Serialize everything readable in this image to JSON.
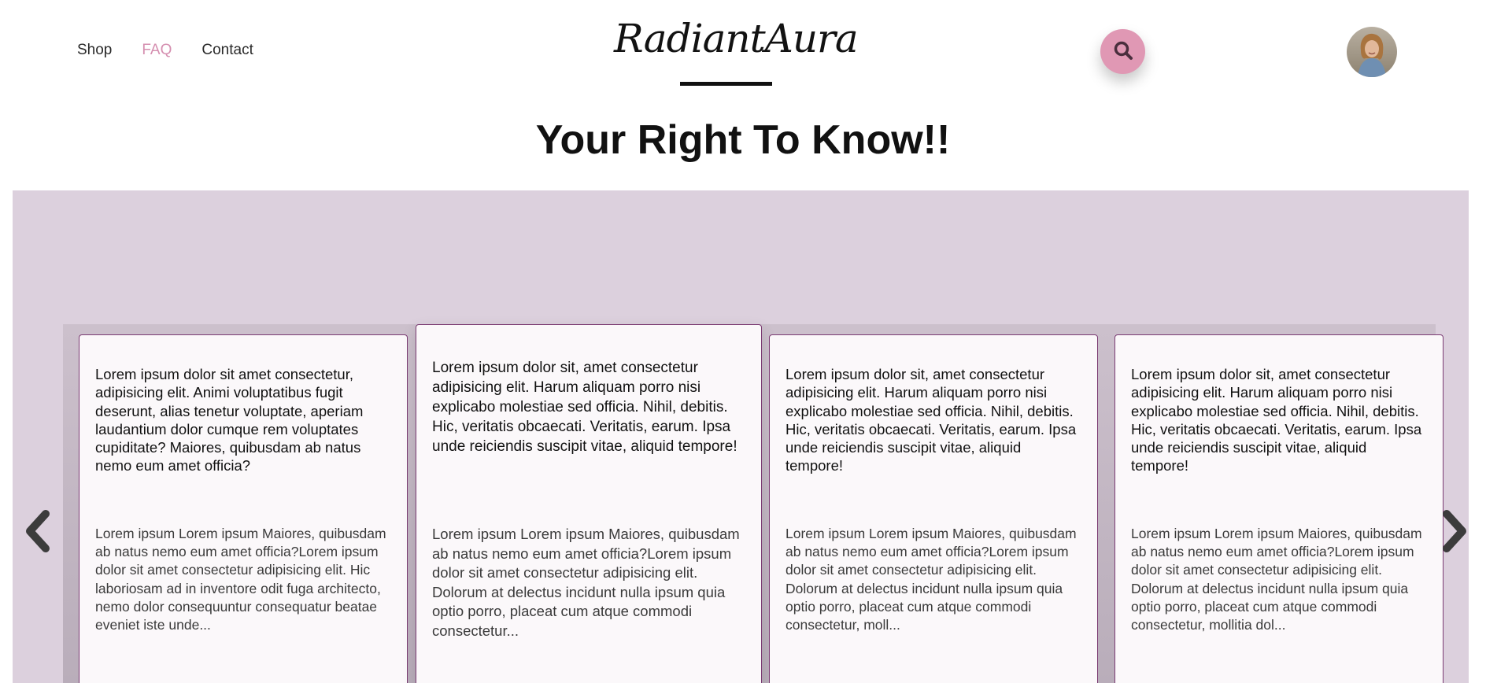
{
  "nav": {
    "items": [
      {
        "label": "Shop",
        "active": false
      },
      {
        "label": "FAQ",
        "active": true
      },
      {
        "label": "Contact",
        "active": false
      }
    ]
  },
  "brand": {
    "name": "RadiantAura"
  },
  "page": {
    "title": "Your Right To Know!!"
  },
  "colors": {
    "accent": "#e098b4",
    "active_link": "#d58fb0",
    "band": "#dcd0dd",
    "card_border": "#7a3a72"
  },
  "icons": {
    "search": "search-icon",
    "prev": "chevron-left-icon",
    "next": "chevron-right-icon"
  },
  "faq": {
    "cards": [
      {
        "question": "Lorem ipsum dolor sit amet consectetur, adipisicing elit. Animi voluptatibus fugit deserunt, alias tenetur voluptate, aperiam laudantium dolor cumque rem voluptates cupiditate? Maiores, quibusdam ab natus nemo eum amet officia?",
        "answer": "Lorem ipsum Lorem ipsum Maiores, quibusdam ab natus nemo eum amet officia?Lorem ipsum dolor sit amet consectetur adipisicing elit. Hic laboriosam ad in inventore odit fuga architecto, nemo dolor consequuntur consequatur beatae eveniet iste unde..."
      },
      {
        "question": "Lorem ipsum dolor sit, amet consectetur adipisicing elit. Harum aliquam porro nisi explicabo molestiae sed officia. Nihil, debitis. Hic, veritatis obcaecati. Veritatis, earum. Ipsa unde reiciendis suscipit vitae, aliquid tempore!",
        "answer": "Lorem ipsum Lorem ipsum Maiores, quibusdam ab natus nemo eum amet officia?Lorem ipsum dolor sit amet consectetur adipisicing elit. Dolorum at delectus incidunt nulla ipsum quia optio porro, placeat cum atque commodi consectetur..."
      },
      {
        "question": "Lorem ipsum dolor sit, amet consectetur adipisicing elit. Harum aliquam porro nisi explicabo molestiae sed officia. Nihil, debitis. Hic, veritatis obcaecati. Veritatis, earum. Ipsa unde reiciendis suscipit vitae, aliquid tempore!",
        "answer": "Lorem ipsum Lorem ipsum Maiores, quibusdam ab natus nemo eum amet officia?Lorem ipsum dolor sit amet consectetur adipisicing elit. Dolorum at delectus incidunt nulla ipsum quia optio porro, placeat cum atque commodi consectetur, moll..."
      },
      {
        "question": "Lorem ipsum dolor sit, amet consectetur adipisicing elit. Harum aliquam porro nisi explicabo molestiae sed officia. Nihil, debitis. Hic, veritatis obcaecati. Veritatis, earum. Ipsa unde reiciendis suscipit vitae, aliquid tempore!",
        "answer": "Lorem ipsum Lorem ipsum Maiores, quibusdam ab natus nemo eum amet officia?Lorem ipsum dolor sit amet consectetur adipisicing elit. Dolorum at delectus incidunt nulla ipsum quia optio porro, placeat cum atque commodi consectetur, mollitia dol..."
      }
    ]
  }
}
